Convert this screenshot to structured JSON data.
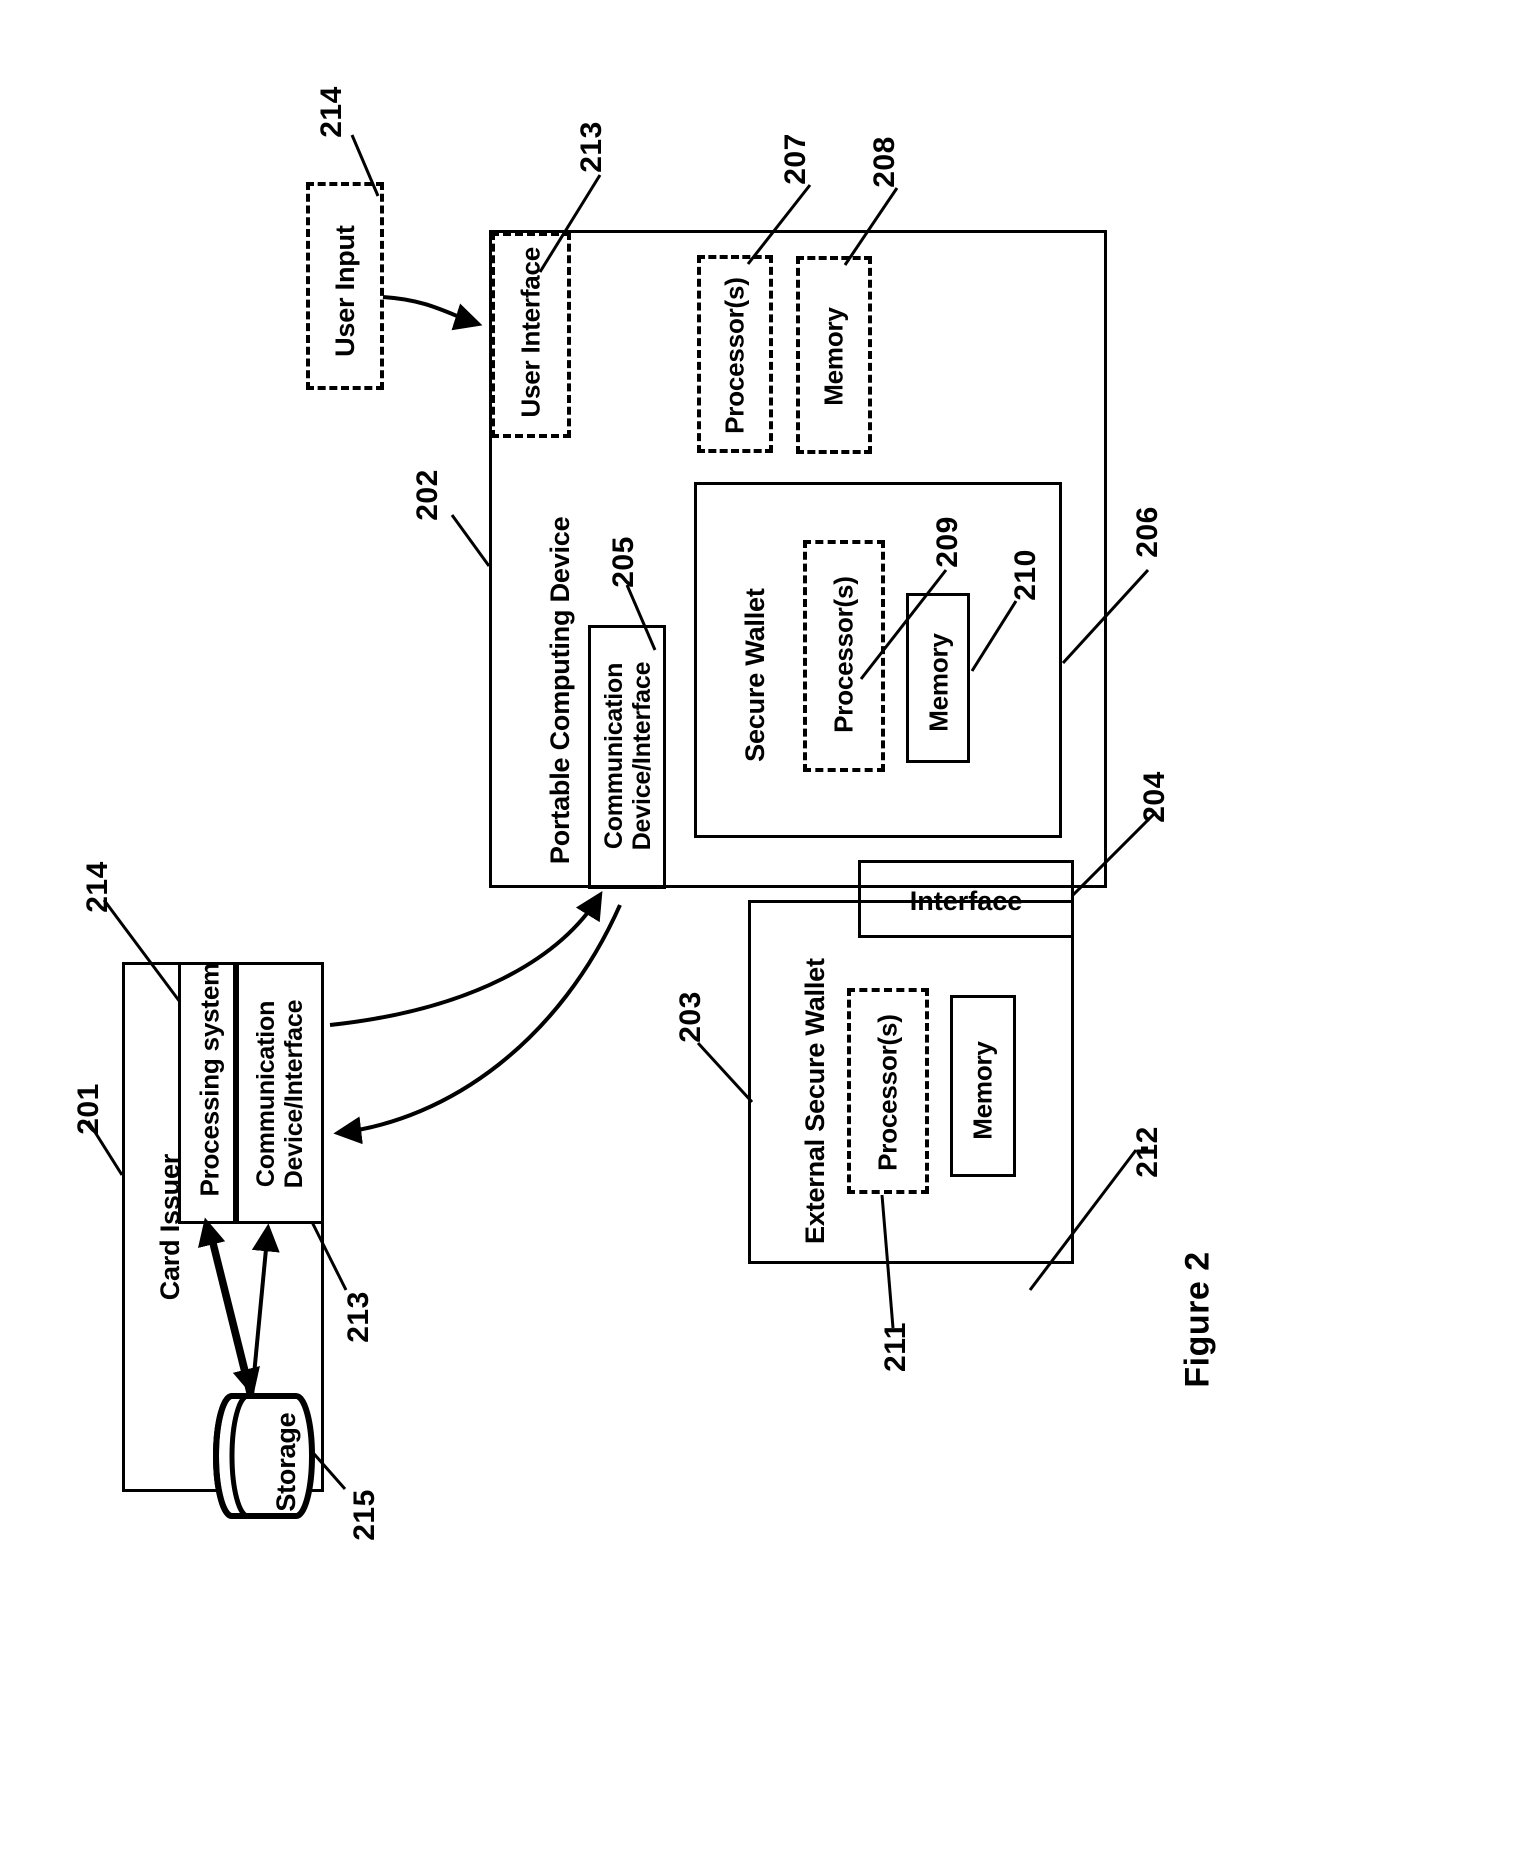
{
  "figure": {
    "caption": "Figure 2"
  },
  "blocks": {
    "user_input": {
      "label": "User Input",
      "ref": "214",
      "style": "dashed"
    },
    "portable_computing_device": {
      "label": "Portable Computing Device",
      "ref": "202",
      "style": "solid"
    },
    "user_interface": {
      "label": "User Interface",
      "ref": "213",
      "style": "dashed"
    },
    "pcd_processors": {
      "label": "Processor(s)",
      "ref": "207",
      "style": "dashed"
    },
    "pcd_memory": {
      "label": "Memory",
      "ref": "208",
      "style": "dashed"
    },
    "communication_device_interface": {
      "label": "Communication\nDevice/Interface",
      "label_line1": "Communication",
      "label_line2": "Device/Interface",
      "ref": "205",
      "style": "solid"
    },
    "secure_wallet": {
      "label": "Secure Wallet",
      "ref": "206",
      "style": "solid"
    },
    "sw_processors": {
      "label": "Processor(s)",
      "ref": "209",
      "style": "dashed"
    },
    "sw_memory": {
      "label": "Memory",
      "ref": "210",
      "style": "solid"
    },
    "interface": {
      "label": "Interface",
      "ref": "204",
      "style": "solid"
    },
    "external_secure_wallet": {
      "label": "External Secure Wallet",
      "ref": "203",
      "style": "solid"
    },
    "esw_processors": {
      "label": "Processor(s)",
      "ref": "211",
      "style": "dashed"
    },
    "esw_memory": {
      "label": "Memory",
      "ref": "212",
      "style": "solid"
    },
    "card_issuer": {
      "label": "Card Issuer",
      "ref": "201",
      "style": "solid"
    },
    "processing_system": {
      "label": "Processing system",
      "ref": "214",
      "style": "solid"
    },
    "ci_communication_device_interface": {
      "label_line1": "Communication",
      "label_line2": "Device/Interface",
      "ref": "213",
      "style": "solid"
    },
    "storage": {
      "label": "Storage",
      "ref": "215",
      "style": "cylinder"
    }
  },
  "reference_numerals": [
    {
      "id": "214a",
      "text": "214"
    },
    {
      "id": "213a",
      "text": "213"
    },
    {
      "id": "207",
      "text": "207"
    },
    {
      "id": "208",
      "text": "208"
    },
    {
      "id": "202",
      "text": "202"
    },
    {
      "id": "209",
      "text": "209"
    },
    {
      "id": "205",
      "text": "205"
    },
    {
      "id": "210",
      "text": "210"
    },
    {
      "id": "206",
      "text": "206"
    },
    {
      "id": "204",
      "text": "204"
    },
    {
      "id": "203",
      "text": "203"
    },
    {
      "id": "211",
      "text": "211"
    },
    {
      "id": "212",
      "text": "212"
    },
    {
      "id": "201",
      "text": "201"
    },
    {
      "id": "214b",
      "text": "214"
    },
    {
      "id": "213b",
      "text": "213"
    },
    {
      "id": "215",
      "text": "215"
    }
  ],
  "colors": {
    "stroke": "#000000",
    "background": "#ffffff"
  }
}
